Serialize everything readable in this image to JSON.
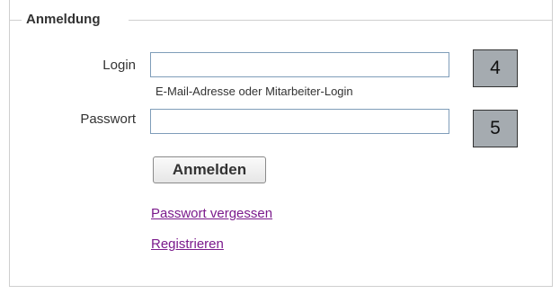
{
  "form": {
    "legend": "Anmeldung",
    "login_label": "Login",
    "login_value": "",
    "login_hint": "E-Mail-Adresse oder Mitarbeiter-Login",
    "password_label": "Passwort",
    "password_value": "",
    "submit_label": "Anmelden",
    "forgot_password_link": "Passwort vergessen",
    "register_link": "Registrieren"
  },
  "annotations": {
    "badge_login": "4",
    "badge_password": "5"
  },
  "colors": {
    "link": "#7b1a8c",
    "badge_background": "#a5abb0",
    "input_border": "#7f9db9"
  }
}
